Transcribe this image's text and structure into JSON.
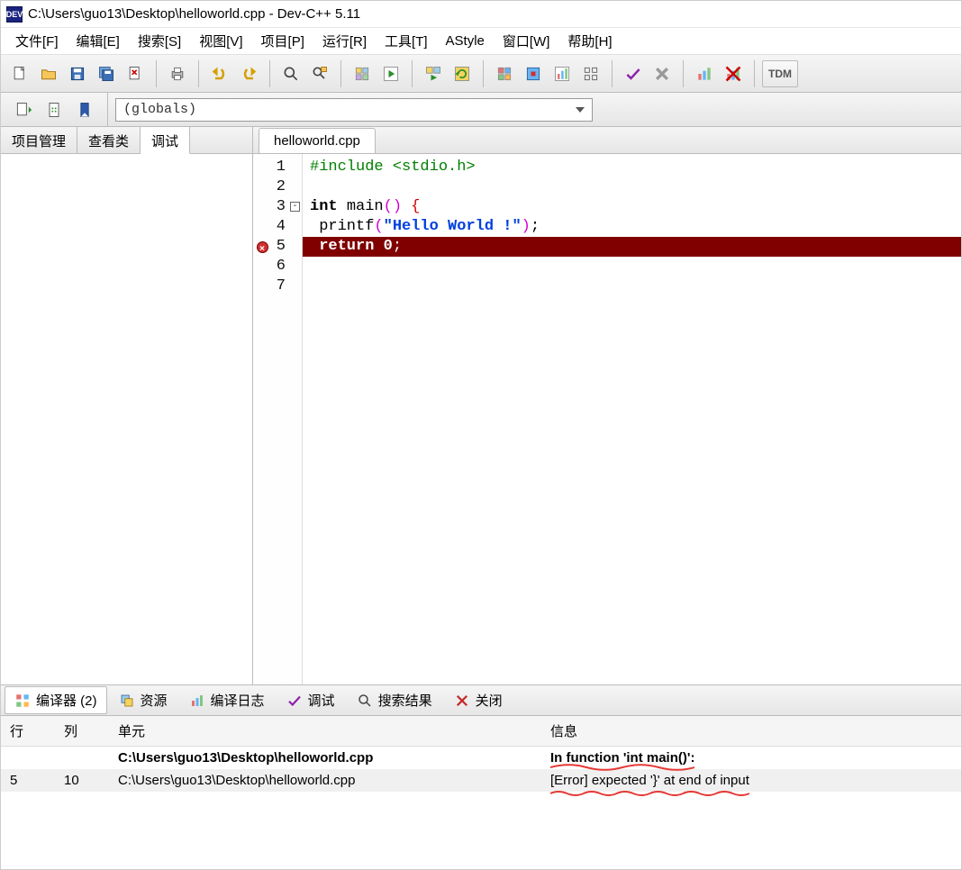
{
  "window": {
    "app_icon_text": "DEV",
    "title": "C:\\Users\\guo13\\Desktop\\helloworld.cpp - Dev-C++ 5.11"
  },
  "menu": {
    "file": "文件[F]",
    "edit": "编辑[E]",
    "search": "搜索[S]",
    "view": "视图[V]",
    "project": "项目[P]",
    "run": "运行[R]",
    "tools": "工具[T]",
    "astyle": "AStyle",
    "window": "窗口[W]",
    "help": "帮助[H]"
  },
  "toolbar": {
    "tdm_label": "TDM"
  },
  "globals_dropdown": {
    "value": "(globals)"
  },
  "left_panel": {
    "tab_project": "项目管理",
    "tab_classes": "查看类",
    "tab_debug": "调试"
  },
  "editor": {
    "file_tab": "helloworld.cpp",
    "lines": [
      {
        "n": "1",
        "html": "<span class='tk-pp'>#include &lt;stdio.h&gt;</span>"
      },
      {
        "n": "2",
        "html": ""
      },
      {
        "n": "3",
        "fold": "-",
        "html": "<span class='tk-kw'>int</span> <span class='tk-fn'>main</span><span class='tk-par'>()</span> <span class='tk-br'>{</span>"
      },
      {
        "n": "4",
        "html": " <span class='tk-fn'>printf</span><span class='tk-par'>(</span><span class='tk-str'>\"Hello World !\"</span><span class='tk-par'>)</span>;"
      },
      {
        "n": "5",
        "bp": true,
        "error": true,
        "html": " <span class='tk-kw'>return</span> <span class='tk-num'>0</span>;"
      },
      {
        "n": "6",
        "html": ""
      },
      {
        "n": "7",
        "html": ""
      }
    ]
  },
  "bottom_tabs": {
    "compiler": "编译器 (2)",
    "resource": "资源",
    "log": "编译日志",
    "debug": "调试",
    "search": "搜索结果",
    "close": "关闭"
  },
  "compiler": {
    "col_line": "行",
    "col_col": "列",
    "col_unit": "单元",
    "col_msg": "信息",
    "rows": [
      {
        "line": "",
        "col": "",
        "unit": "C:\\Users\\guo13\\Desktop\\helloworld.cpp",
        "msg": "In function 'int main()':",
        "bold": true,
        "annot_underline": true
      },
      {
        "line": "5",
        "col": "10",
        "unit": "C:\\Users\\guo13\\Desktop\\helloworld.cpp",
        "msg": "[Error] expected '}' at end of input",
        "sel": true,
        "annot_squiggle": true
      }
    ]
  }
}
